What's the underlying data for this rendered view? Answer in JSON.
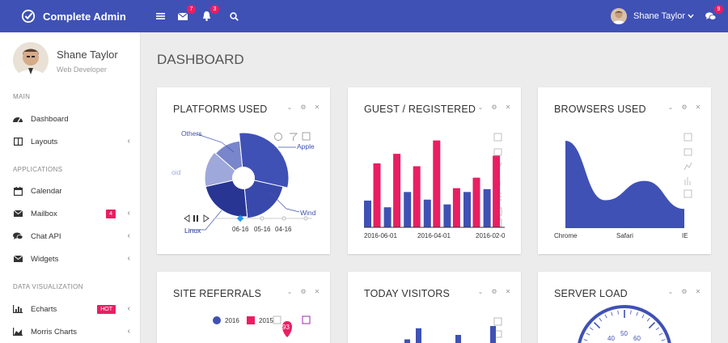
{
  "app": {
    "brand": "Complete Admin"
  },
  "topbar": {
    "mail_count": "7",
    "notif_count": "3",
    "chat_count": "9",
    "user_name": "Shane Taylor"
  },
  "sidebar": {
    "profile": {
      "name": "Shane Taylor",
      "role": "Web Developer"
    },
    "sections": [
      "MAIN",
      "APPLICATIONS",
      "DATA VISUALIZATION"
    ],
    "items": [
      {
        "label": "Dashboard",
        "icon": "dashboard-icon"
      },
      {
        "label": "Layouts",
        "icon": "layout-icon"
      },
      {
        "label": "Calendar",
        "icon": "calendar-icon"
      },
      {
        "label": "Mailbox",
        "icon": "envelope-icon",
        "badge": "4"
      },
      {
        "label": "Chat API",
        "icon": "comments-icon"
      },
      {
        "label": "Widgets",
        "icon": "envelope-icon"
      },
      {
        "label": "Echarts",
        "icon": "bar-chart-icon",
        "badge": "HOT"
      },
      {
        "label": "Morris Charts",
        "icon": "area-chart-icon"
      }
    ]
  },
  "page": {
    "title": "DASHBOARD"
  },
  "cards": {
    "platforms": {
      "title": "PLATFORMS USED"
    },
    "guest": {
      "title": "GUEST / REGISTERED"
    },
    "browsers": {
      "title": "BROWSERS USED"
    },
    "referrals": {
      "title": "SITE REFERRALS",
      "pin_value": "93"
    },
    "visitors": {
      "title": "TODAY VISITORS"
    },
    "server": {
      "title": "SERVER LOAD"
    }
  },
  "colors": {
    "primary": "#3f51b5",
    "accent": "#e91e63",
    "light": "#9fa8da",
    "dark": "#283593"
  },
  "chart_data": [
    {
      "type": "pie",
      "title": "PLATFORMS USED",
      "labels": [
        "Others",
        "Apple",
        "Wind",
        "Linux",
        "oid"
      ],
      "values": [
        12,
        30,
        20,
        23,
        15
      ],
      "timeline": [
        "06-16",
        "05-16",
        "04-16"
      ]
    },
    {
      "type": "bar",
      "title": "GUEST / REGISTERED",
      "categories": [
        "2016-06-01",
        "",
        "",
        "2016-04-01",
        "",
        "",
        "2016-02-0"
      ],
      "series": [
        {
          "values": [
            28,
            21,
            37,
            29,
            24,
            37,
            40
          ],
          "color": "#3f51b5"
        },
        {
          "values": [
            67,
            77,
            64,
            91,
            41,
            52,
            75
          ],
          "color": "#e91e63"
        }
      ],
      "ylim": [
        0,
        100
      ]
    },
    {
      "type": "area",
      "title": "BROWSERS USED",
      "categories": [
        "Chrome",
        "Safari",
        "IE"
      ],
      "values": [
        100,
        32,
        54,
        22
      ],
      "ylim": [
        0,
        100
      ]
    },
    {
      "type": "scatter",
      "title": "SITE REFERRALS",
      "legend": [
        "2016",
        "2015"
      ]
    },
    {
      "type": "bar",
      "title": "TODAY VISITORS",
      "values": [
        30,
        55,
        40,
        60
      ]
    },
    {
      "type": "gauge",
      "title": "SERVER LOAD",
      "ticks": [
        "40",
        "50",
        "60"
      ]
    }
  ]
}
